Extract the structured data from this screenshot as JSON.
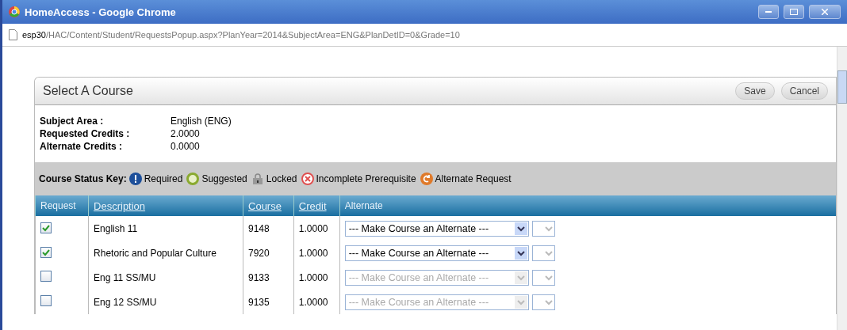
{
  "window": {
    "title": "HomeAccess - Google Chrome"
  },
  "address_bar": {
    "host": "esp30",
    "path": "/HAC/Content/Student/RequestsPopup.aspx?PlanYear=2014&SubjectArea=ENG&PlanDetID=0&Grade=10"
  },
  "dialog": {
    "title": "Select A Course",
    "buttons": [
      "Save",
      "Cancel"
    ]
  },
  "info": [
    {
      "label": "Subject Area :",
      "value": "English (ENG)"
    },
    {
      "label": "Requested Credits :",
      "value": "2.0000"
    },
    {
      "label": "Alternate Credits :",
      "value": "0.0000"
    }
  ],
  "status_key": {
    "label": "Course Status Key:",
    "items": [
      {
        "kind": "required",
        "label": "Required"
      },
      {
        "kind": "suggested",
        "label": "Suggested"
      },
      {
        "kind": "locked",
        "label": "Locked"
      },
      {
        "kind": "incomplete",
        "label": "Incomplete Prerequisite"
      },
      {
        "kind": "alternate",
        "label": "Alternate Request"
      }
    ]
  },
  "table": {
    "columns": [
      {
        "label": "Request",
        "sortable": false
      },
      {
        "label": "Description",
        "sortable": true
      },
      {
        "label": "Course",
        "sortable": true
      },
      {
        "label": "Credit",
        "sortable": true
      },
      {
        "label": "Alternate",
        "sortable": false
      }
    ],
    "rows": [
      {
        "checked": true,
        "description": "English 11",
        "course": "9148",
        "credit": "1.0000",
        "alternate": "--- Make Course an Alternate ---",
        "alternate_disabled": false
      },
      {
        "checked": true,
        "description": "Rhetoric and Popular Culture",
        "course": "7920",
        "credit": "1.0000",
        "alternate": "--- Make Course an Alternate ---",
        "alternate_disabled": false
      },
      {
        "checked": false,
        "description": "Eng 11 SS/MU",
        "course": "9133",
        "credit": "1.0000",
        "alternate": "--- Make Course an Alternate ---",
        "alternate_disabled": true
      },
      {
        "checked": false,
        "description": "Eng 12 SS/MU",
        "course": "9135",
        "credit": "1.0000",
        "alternate": "--- Make Course an Alternate ---",
        "alternate_disabled": true
      }
    ]
  }
}
